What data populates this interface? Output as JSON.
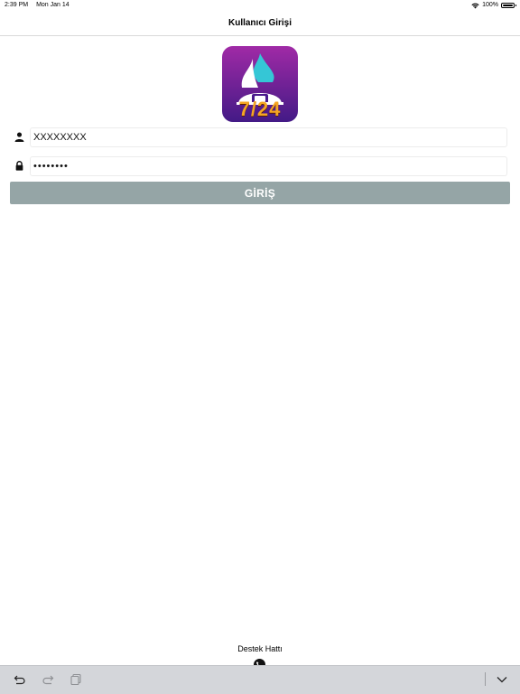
{
  "status_bar": {
    "time": "2:39 PM",
    "date": "Mon Jan 14",
    "battery": "100%"
  },
  "nav": {
    "title": "Kullanıcı Girişi"
  },
  "logo": {
    "text": "7/24",
    "colors": {
      "background_top": "#9c2aa8",
      "background_bottom": "#4a1a8c",
      "accent_teal": "#35c6d6",
      "accent_orange": "#f5a623"
    }
  },
  "login_form": {
    "username_value": "XXXXXXXX",
    "password_value": "••••••••",
    "submit_label": "GİRİŞ",
    "submit_color": "#95a5a6",
    "username_icon": "user-icon",
    "password_icon": "lock-icon"
  },
  "support": {
    "label": "Destek Hattı",
    "icon": "phone-icon"
  },
  "keyboard_toolbar": {
    "icons": [
      "undo-icon",
      "redo-icon",
      "paste-icon",
      "chevron-down-icon"
    ]
  }
}
